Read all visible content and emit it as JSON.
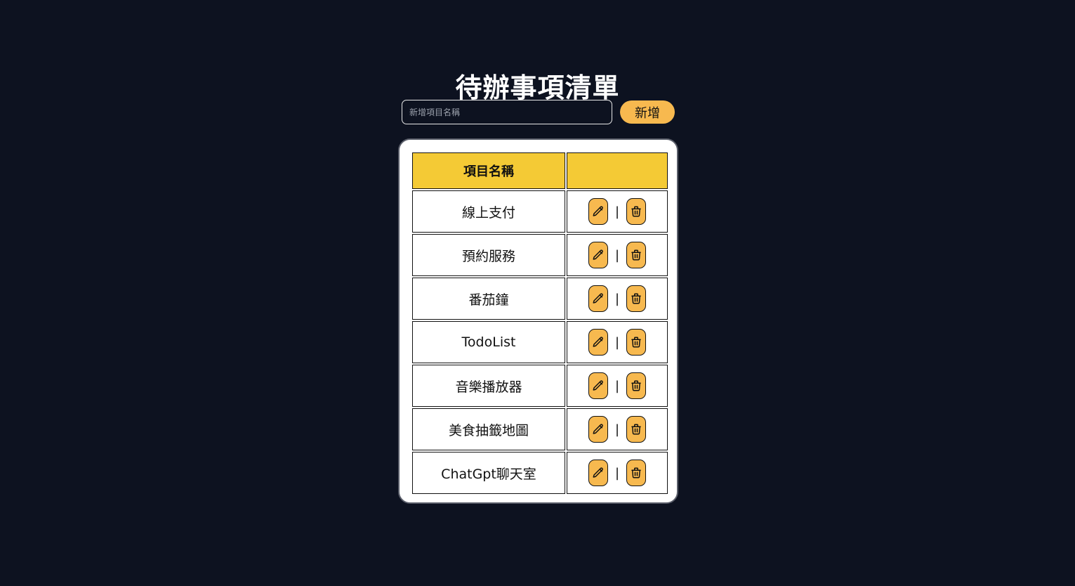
{
  "page": {
    "title": "待辦事項清單"
  },
  "add_form": {
    "placeholder": "新增項目名稱",
    "button_label": "新增"
  },
  "table": {
    "headers": [
      "項目名稱",
      ""
    ],
    "separator": "|",
    "rows": [
      {
        "name": "線上支付"
      },
      {
        "name": "預約服務"
      },
      {
        "name": "番茄鐘"
      },
      {
        "name": "TodoList"
      },
      {
        "name": "音樂播放器"
      },
      {
        "name": "美食抽籤地圖"
      },
      {
        "name": "ChatGpt聊天室"
      }
    ],
    "row_actions": [
      {
        "icon": "pencil-icon",
        "action": "edit"
      },
      {
        "icon": "trash-icon",
        "action": "delete"
      }
    ]
  },
  "colors": {
    "background": "#0d1220",
    "header_yellow": "#f4ca35",
    "button_orange": "#f7b94f",
    "card": "#ffffff"
  }
}
